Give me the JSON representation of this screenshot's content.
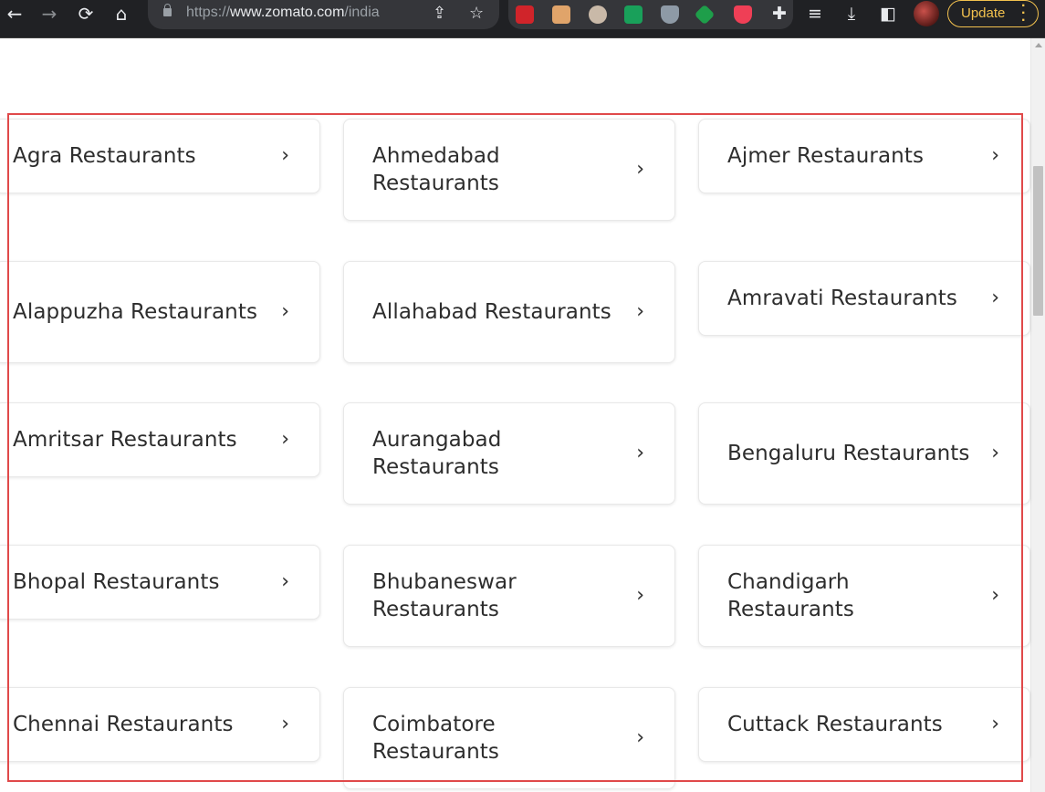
{
  "browser": {
    "url_scheme": "https://",
    "url_host": "www.zomato.com",
    "url_path": "/india",
    "update_label": "Update"
  },
  "cities": [
    "Agra Restaurants",
    "Ahmedabad Restaurants",
    "Ajmer Restaurants",
    "Alappuzha Restaurants",
    "Allahabad Restaurants",
    "Amravati Restaurants",
    "Amritsar Restaurants",
    "Aurangabad Restaurants",
    "Bengaluru Restaurants",
    "Bhopal Restaurants",
    "Bhubaneswar Restaurants",
    "Chandigarh Restaurants",
    "Chennai Restaurants",
    "Coimbatore Restaurants",
    "Cuttack Restaurants"
  ]
}
